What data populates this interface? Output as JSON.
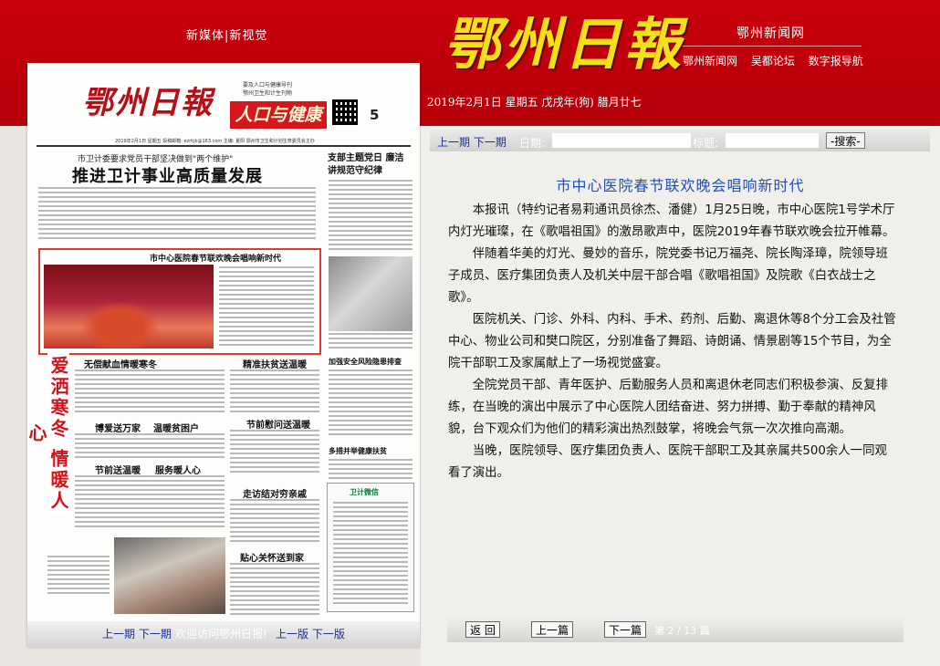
{
  "header": {
    "slogan": "新媒体|新视觉",
    "masthead": "鄂州日報",
    "site_title": "鄂州新闻网",
    "site_links": [
      "鄂州新闻网",
      "吴都论坛",
      "数字报导航"
    ],
    "date_line": "2019年2月1日 星期五 戊戌年(狗) 腊月廿七"
  },
  "page_image": {
    "logo": "鄂州日報",
    "small_text": [
      "要及人口与健康导刊",
      "鄂州卫生和计生刊物"
    ],
    "section": "人口与健康",
    "page_number": "5",
    "info_line": "2019年2月1日 星期五    投稿邮箱: ezrkjk@163.com    主编: 夏阳    鄂州市卫生和计划生育委员会主办",
    "kicker": "市卫计委要求党员干部坚决做到\"两个维护\"",
    "headline": "推进卫计事业高质量发展",
    "side_headline": "支部主题党日 廉洁讲规范守纪律",
    "feature_caption": "市中心医院春节联欢晚会唱响新时代",
    "vertical_band": "爱洒寒冬 情暖人心",
    "sub_heads": [
      "无偿献血情暖寒冬",
      "精准扶贫送温暖",
      "博爱送万家",
      "温暖贫困户",
      "节前慰问送温暖",
      "节前送温暖",
      "服务暖人心",
      "走访结对穷亲戚",
      "贴心关怀送到家",
      "加强安全风险隐患排查",
      "多措并举健康扶贫"
    ],
    "ad_title": "卫计微信"
  },
  "page_bar": {
    "prev_next": "上一期 下一期",
    "note": "欢迎访问鄂州日报!",
    "prev_next_page": "上一版 下一版"
  },
  "search": {
    "prev_next": "上一期 下一期",
    "date_label": "日期:",
    "title_label": "标题:",
    "button": "-搜索-",
    "date_value": "",
    "title_value": ""
  },
  "article": {
    "title": "市中心医院春节联欢晚会唱响新时代",
    "paragraphs": [
      "本报讯（特约记者易莉通讯员徐杰、潘健）1月25日晚，市中心医院1号学术厅内灯光璀璨，在《歌唱祖国》的激昂歌声中，医院2019年春节联欢晚会拉开帷幕。",
      "伴随着华美的灯光、曼妙的音乐，院党委书记万福尧、院长陶泽璋，院领导班子成员、医疗集团负责人及机关中层干部合唱《歌唱祖国》及院歌《白衣战士之歌》。",
      "医院机关、门诊、外科、内科、手术、药剂、后勤、离退休等8个分工会及社管中心、物业公司和樊口院区，分别准备了舞蹈、诗朗诵、情景剧等15个节目，为全院干部职工及家属献上了一场视觉盛宴。",
      "全院党员干部、青年医护、后勤服务人员和离退休老同志们积极参演、反复排练，在当晚的演出中展示了中心医院人团结奋进、努力拼搏、勤于奉献的精神风貌，台下观众们为他们的精彩演出热烈鼓掌，将晚会气氛一次次推向高潮。",
      "当晚，医院领导、医疗集团负责人、医院干部职工及其亲属共500余人一同观看了演出。"
    ]
  },
  "bottom_nav": {
    "back": "返 回",
    "prev": "上一篇",
    "next": "下一篇",
    "page_indicator": "第 2 / 13 篇"
  }
}
